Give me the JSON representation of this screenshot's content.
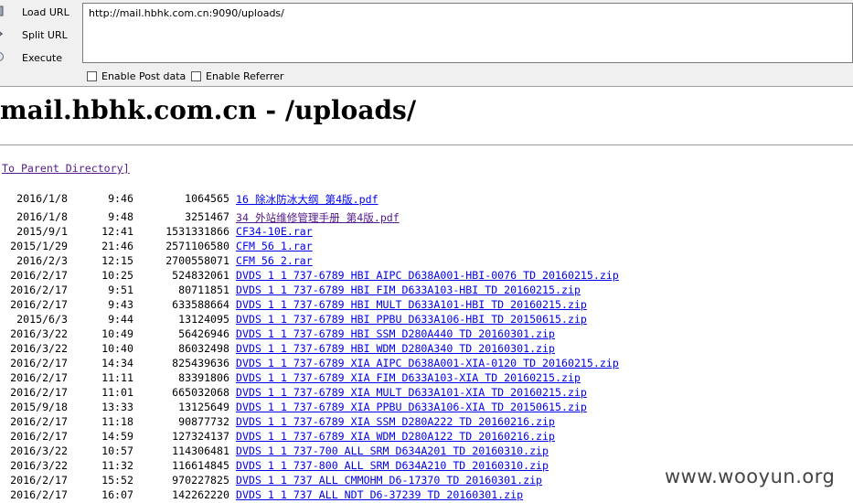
{
  "toolbar": {
    "buttons": [
      {
        "label": "Load URL"
      },
      {
        "label": "Split URL"
      },
      {
        "label": "Execute"
      }
    ],
    "url": "http://mail.hbhk.com.cn:9090/uploads/",
    "checkboxes": [
      {
        "label": "Enable Post data",
        "checked": false
      },
      {
        "label": "Enable Referrer",
        "checked": false
      }
    ]
  },
  "page": {
    "title": "mail.hbhk.com.cn - /uploads/",
    "parent_link": "To Parent Directory]"
  },
  "files": [
    {
      "date": "2016/1/8",
      "time": "9:46",
      "size": "1064565",
      "name": "16 除冰防冰大纲 第4版.pdf",
      "visited": false
    },
    {
      "date": "2016/1/8",
      "time": "9:48",
      "size": "3251467",
      "name": "34 外站维修管理手册 第4版.pdf",
      "visited": true
    },
    {
      "date": "2015/9/1",
      "time": "12:41",
      "size": "1531331866",
      "name": "CF34-10E.rar",
      "visited": false
    },
    {
      "date": "2015/1/29",
      "time": "21:46",
      "size": "2571106580",
      "name": "CFM 56 1.rar",
      "visited": false
    },
    {
      "date": "2016/2/3",
      "time": "12:15",
      "size": "2700558071",
      "name": "CFM 56 2.rar",
      "visited": false
    },
    {
      "date": "2016/2/17",
      "time": "10:25",
      "size": "524832061",
      "name": "DVDS 1 1 737-6789 HBI AIPC D638A001-HBI-0076 TD 20160215.zip",
      "visited": false
    },
    {
      "date": "2016/2/17",
      "time": "9:51",
      "size": "80711851",
      "name": "DVDS 1 1 737-6789 HBI FIM D633A103-HBI TD 20160215.zip",
      "visited": false
    },
    {
      "date": "2016/2/17",
      "time": "9:43",
      "size": "633588664",
      "name": "DVDS 1 1 737-6789 HBI MULT D633A101-HBI TD 20160215.zip",
      "visited": false
    },
    {
      "date": "2015/6/3",
      "time": "9:44",
      "size": "13124095",
      "name": "DVDS 1 1 737-6789 HBI PPBU D633A106-HBI TD 20150615.zip",
      "visited": false
    },
    {
      "date": "2016/3/22",
      "time": "10:49",
      "size": "56426946",
      "name": "DVDS 1 1 737-6789 HBI SSM D280A440 TD 20160301.zip",
      "visited": false
    },
    {
      "date": "2016/3/22",
      "time": "10:40",
      "size": "86032498",
      "name": "DVDS 1 1 737-6789 HBI WDM D280A340 TD 20160301.zip",
      "visited": false
    },
    {
      "date": "2016/2/17",
      "time": "14:34",
      "size": "825439636",
      "name": "DVDS 1 1 737-6789 XIA AIPC D638A001-XIA-0120 TD 20160215.zip",
      "visited": false
    },
    {
      "date": "2016/2/17",
      "time": "11:11",
      "size": "83391806",
      "name": "DVDS 1 1 737-6789 XIA FIM D633A103-XIA TD 20160215.zip",
      "visited": false
    },
    {
      "date": "2016/2/17",
      "time": "11:01",
      "size": "665032068",
      "name": "DVDS 1 1 737-6789 XIA MULT D633A101-XIA TD 20160215.zip",
      "visited": false
    },
    {
      "date": "2015/9/18",
      "time": "13:33",
      "size": "13125649",
      "name": "DVDS 1 1 737-6789 XIA PPBU D633A106-XIA TD 20150615.zip",
      "visited": false
    },
    {
      "date": "2016/2/17",
      "time": "11:18",
      "size": "90877732",
      "name": "DVDS 1 1 737-6789 XIA SSM D280A222 TD 20160216.zip",
      "visited": false
    },
    {
      "date": "2016/2/17",
      "time": "14:59",
      "size": "127324137",
      "name": "DVDS 1 1 737-6789 XIA WDM D280A122 TD 20160216.zip",
      "visited": false
    },
    {
      "date": "2016/3/22",
      "time": "10:57",
      "size": "114306481",
      "name": "DVDS 1 1 737-700 ALL SRM D634A201 TD 20160310.zip",
      "visited": false
    },
    {
      "date": "2016/3/22",
      "time": "11:32",
      "size": "116614845",
      "name": "DVDS 1 1 737-800 ALL SRM D634A210 TD 20160310.zip",
      "visited": false
    },
    {
      "date": "2016/2/17",
      "time": "15:52",
      "size": "970227825",
      "name": "DVDS 1 1 737 ALL CMMOHM D6-17370 TD 20160301.zip",
      "visited": false
    },
    {
      "date": "2016/2/17",
      "time": "16:07",
      "size": "142262220",
      "name": "DVDS 1 1 737 ALL NDT D6-37239 TD 20160301.zip",
      "visited": false
    }
  ],
  "watermark": "www.wooyun.org"
}
